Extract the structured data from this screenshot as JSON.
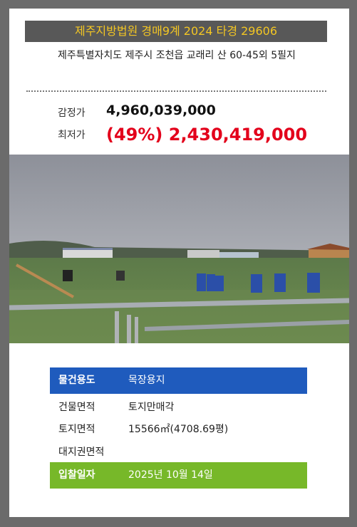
{
  "header": {
    "title": "제주지방법원 경매9계 2024 타경 29606"
  },
  "property": {
    "address": "제주특별자치도 제주시 조천읍 교래리 산 60-45외 5필지"
  },
  "prices": {
    "appraised_label": "감정가",
    "appraised_value": "4,960,039,000",
    "minimum_label": "최저가",
    "minimum_value": "(49%) 2,430,419,000"
  },
  "details": {
    "use_label": "물건용도",
    "use_value": "목장용지",
    "building_label": "건물면적",
    "building_value": "토지만매각",
    "land_label": "토지면적",
    "land_value": "15566㎡(4708.69평)",
    "right_label": "대지권면적",
    "right_value": "",
    "bid_label": "입찰일자",
    "bid_value": "2025년 10월 14일"
  },
  "colors": {
    "accent_blue": "#1f5bbd",
    "accent_green": "#77b829",
    "price_red": "#e3001b",
    "title_yellow": "#f3c623"
  }
}
